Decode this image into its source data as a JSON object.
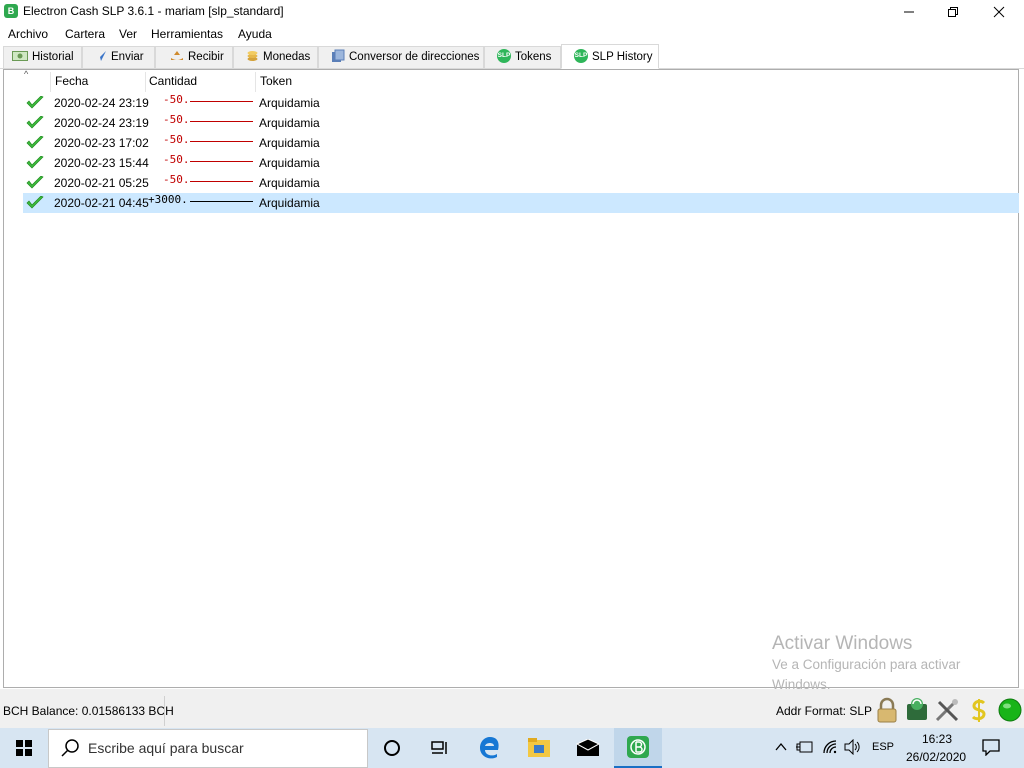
{
  "window": {
    "title": "Electron Cash SLP 3.6.1  -  mariam  [slp_standard]",
    "app_icon_label": "B"
  },
  "menu": [
    "Archivo",
    "Cartera",
    "Ver",
    "Herramientas",
    "Ayuda"
  ],
  "tabs": [
    {
      "label": "Historial",
      "icon": "history-icon"
    },
    {
      "label": "Enviar",
      "icon": "send-icon"
    },
    {
      "label": "Recibir",
      "icon": "receive-icon"
    },
    {
      "label": "Monedas",
      "icon": "coins-icon"
    },
    {
      "label": "Conversor de direcciones",
      "icon": "address-converter-icon"
    },
    {
      "label": "Tokens",
      "icon": "slp-icon"
    },
    {
      "label": "SLP History",
      "icon": "slp-icon",
      "active": true
    }
  ],
  "table": {
    "columns": [
      "Fecha",
      "Cantidad",
      "Token"
    ],
    "rows": [
      {
        "date": "2020-02-24 23:19",
        "amount": "-50.",
        "token": "Arquidamia",
        "selected": false
      },
      {
        "date": "2020-02-24 23:19",
        "amount": "-50.",
        "token": "Arquidamia",
        "selected": false
      },
      {
        "date": "2020-02-23 17:02",
        "amount": "-50.",
        "token": "Arquidamia",
        "selected": false
      },
      {
        "date": "2020-02-23 15:44",
        "amount": "-50.",
        "token": "Arquidamia",
        "selected": false
      },
      {
        "date": "2020-02-21 05:25",
        "amount": "-50.",
        "token": "Arquidamia",
        "selected": false
      },
      {
        "date": "2020-02-21 04:45",
        "amount": "+3000.",
        "token": "Arquidamia",
        "selected": true
      }
    ]
  },
  "watermark": {
    "line1": "Activar Windows",
    "line2": "Ve a Configuración para activar",
    "line3": "Windows."
  },
  "status": {
    "balance": "BCH Balance: 0.01586133 BCH",
    "addr_format": "Addr Format: SLP",
    "icons": [
      "lock-icon",
      "seed-icon",
      "preferences-icon",
      "slp-dollar-icon",
      "network-status-icon"
    ]
  },
  "taskbar": {
    "search_placeholder": "Escribe aquí para buscar",
    "language": "ESP",
    "time": "16:23",
    "date": "26/02/2020"
  },
  "colors": {
    "selection": "#cce8ff",
    "negative_amount": "#c00000",
    "status_green": "#18b418",
    "taskbar": "#d7e5f2"
  }
}
